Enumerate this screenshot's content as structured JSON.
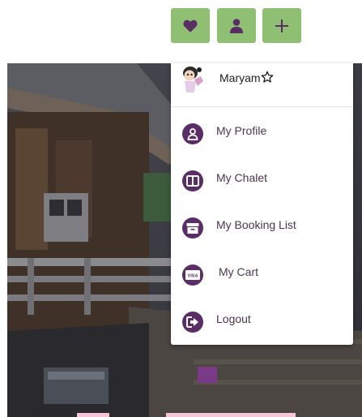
{
  "toolbar": {
    "favorites_icon": "heart-icon",
    "account_icon": "user-icon",
    "add_icon": "plus-icon",
    "button_color": "#8fbf72"
  },
  "menu": {
    "user": {
      "name": "Maryam",
      "badge_icon": "star-outline-icon"
    },
    "items": [
      {
        "label": "My Profile",
        "icon": "user-circle-icon"
      },
      {
        "label": "My Chalet",
        "icon": "chalet-icon"
      },
      {
        "label": "My Booking List",
        "icon": "archive-box-icon"
      },
      {
        "label": "My Cart",
        "icon": "visa-card-icon"
      },
      {
        "label": "Logout",
        "icon": "logout-icon"
      }
    ],
    "icon_color": "#5a2d66"
  }
}
